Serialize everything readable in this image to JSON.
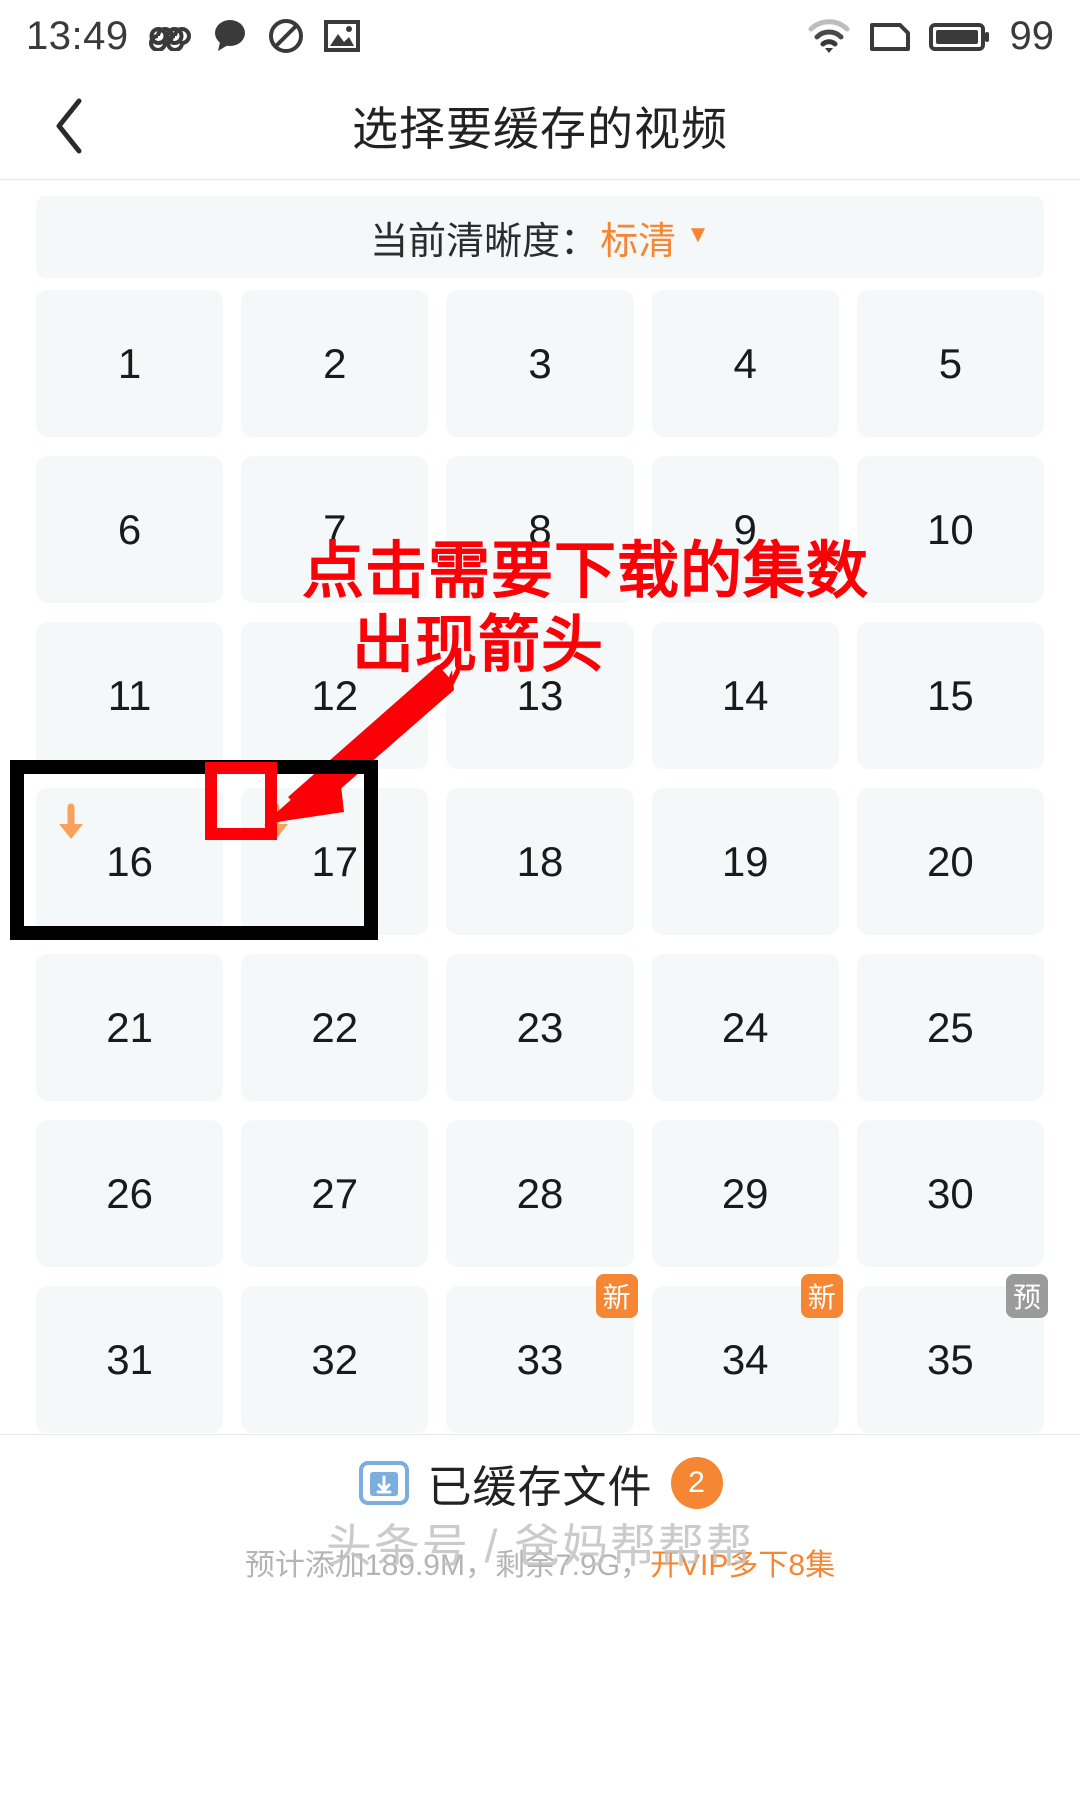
{
  "statusbar": {
    "time": "13:49",
    "battery_level": "99",
    "icons": [
      "infinity-icon",
      "chat-bubble-icon",
      "do-not-disturb-icon",
      "image-icon",
      "wifi-icon",
      "sim-card-icon",
      "battery-icon"
    ]
  },
  "titlebar": {
    "back_label": "‹",
    "title": "选择要缓存的视频"
  },
  "quality": {
    "label": "当前清晰度：",
    "value": "标清",
    "caret": "▼",
    "accent_color": "#f58634"
  },
  "grid": {
    "cells": [
      {
        "num": "1"
      },
      {
        "num": "2"
      },
      {
        "num": "3"
      },
      {
        "num": "4"
      },
      {
        "num": "5"
      },
      {
        "num": "6"
      },
      {
        "num": "7"
      },
      {
        "num": "8"
      },
      {
        "num": "9"
      },
      {
        "num": "10"
      },
      {
        "num": "11"
      },
      {
        "num": "12"
      },
      {
        "num": "13"
      },
      {
        "num": "14"
      },
      {
        "num": "15"
      },
      {
        "num": "16",
        "download": true
      },
      {
        "num": "17",
        "download": true
      },
      {
        "num": "18"
      },
      {
        "num": "19"
      },
      {
        "num": "20"
      },
      {
        "num": "21"
      },
      {
        "num": "22"
      },
      {
        "num": "23"
      },
      {
        "num": "24"
      },
      {
        "num": "25"
      },
      {
        "num": "26"
      },
      {
        "num": "27"
      },
      {
        "num": "28"
      },
      {
        "num": "29"
      },
      {
        "num": "30"
      },
      {
        "num": "31"
      },
      {
        "num": "32"
      },
      {
        "num": "33",
        "badge": "新",
        "badge_type": "new"
      },
      {
        "num": "34",
        "badge": "新",
        "badge_type": "new"
      },
      {
        "num": "35",
        "badge": "预",
        "badge_type": "pre"
      }
    ]
  },
  "annotations": {
    "line1": "点击需要下载的集数",
    "line2": "出现箭头",
    "color": "#fb0007"
  },
  "bottom": {
    "cached_label": "已缓存文件",
    "cached_count": "2",
    "note_prefix": "预计添加189.9M，剩余7.9G，",
    "note_vip": "开VIP多下8集",
    "accent_color": "#f58634"
  },
  "watermark": {
    "text": "头条号 / 爸妈帮帮帮"
  }
}
